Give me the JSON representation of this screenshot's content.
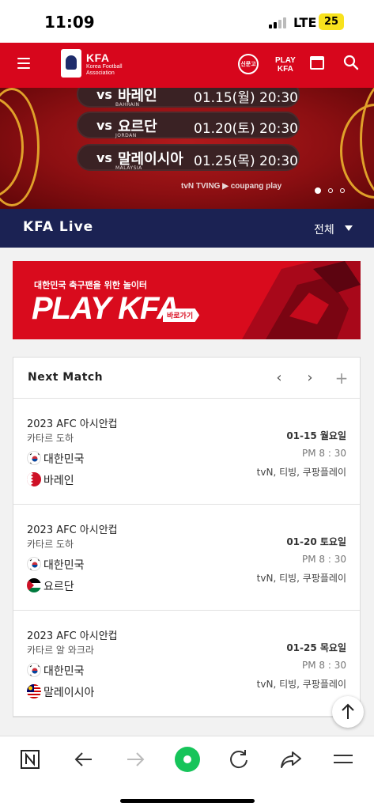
{
  "status_bar": {
    "time": "11:09",
    "network": "LTE",
    "battery": "25"
  },
  "header": {
    "brand_name": "KFA",
    "brand_sub_1": "Korea Football",
    "brand_sub_2": "Association",
    "news_label": "신문고",
    "play_label_1": "PLAY",
    "play_label_2": "KFA"
  },
  "banner": {
    "matches": [
      {
        "vs": "vs",
        "team": "바레인",
        "team_en": "BAHRAIN",
        "datetime": "01.15(월) 20:30"
      },
      {
        "vs": "vs",
        "team": "요르단",
        "team_en": "JORDAN",
        "datetime": "01.20(토) 20:30"
      },
      {
        "vs": "vs",
        "team": "말레이시아",
        "team_en": "MALAYSIA",
        "datetime": "01.25(목) 20:30"
      }
    ],
    "sponsors": "tvN  TVING  ▶ coupang play",
    "slide_count": 3,
    "active_slide": 1
  },
  "live": {
    "title": "KFA Live",
    "filter": "전체"
  },
  "ad": {
    "line1": "대한민국 축구팬을 위한 놀이터",
    "big": "PLAY KFA",
    "cta": "바로가기"
  },
  "next_match": {
    "title": "Next Match",
    "prev_icon": "‹",
    "next_icon": "›",
    "add_icon": "+",
    "matches": [
      {
        "competition": "2023 AFC 아시안컵",
        "venue": "카타르 도하",
        "home": "대한민국",
        "away": "바레인",
        "date": "01-15 월요일",
        "time": "PM 8 : 30",
        "broadcast": "tvN, 티빙, 쿠팡플레이"
      },
      {
        "competition": "2023 AFC 아시안컵",
        "venue": "카타르 도하",
        "home": "대한민국",
        "away": "요르단",
        "date": "01-20 토요일",
        "time": "PM 8 : 30",
        "broadcast": "tvN, 티빙, 쿠팡플레이"
      },
      {
        "competition": "2023 AFC 아시안컵",
        "venue": "카타르 알 와크라",
        "home": "대한민국",
        "away": "말레이시아",
        "date": "01-25 목요일",
        "time": "PM 8 : 30",
        "broadcast": "tvN, 티빙, 쿠팡플레이"
      }
    ]
  },
  "browser_bar": {
    "icons": [
      "naver-icon",
      "back-icon",
      "forward-icon",
      "green-dot-icon",
      "reload-icon",
      "share-icon",
      "menu-icon"
    ]
  },
  "colors": {
    "brand_red": "#d7061c",
    "navy": "#1b2253",
    "gold": "#e0a12a"
  }
}
